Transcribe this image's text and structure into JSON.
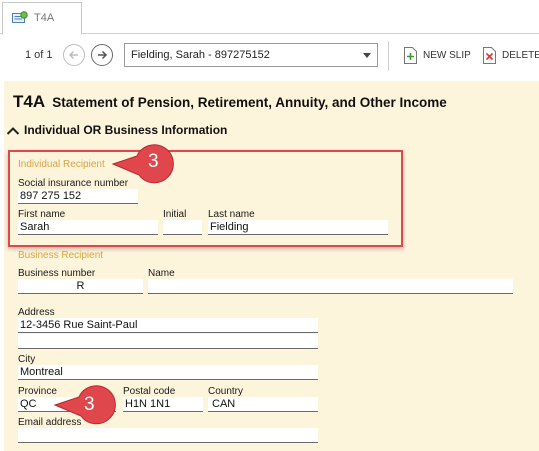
{
  "tab": {
    "label": "T4A"
  },
  "toolbar": {
    "pager": "1 of 1",
    "recipient_select": "Fielding, Sarah - 897275152",
    "new_slip": "NEW SLIP",
    "delete": "DELETE"
  },
  "form": {
    "code": "T4A",
    "title": "Statement of Pension, Retirement, Annuity, and Other Income",
    "section": "Individual OR Business Information",
    "individual": {
      "heading": "Individual Recipient",
      "sin_label": "Social insurance number",
      "sin": "897 275 152",
      "first_name_label": "First name",
      "first_name": "Sarah",
      "initial_label": "Initial",
      "initial": "",
      "last_name_label": "Last name",
      "last_name": "Fielding"
    },
    "business": {
      "heading": "Business Recipient",
      "number_label": "Business number",
      "number_r": "R",
      "name_label": "Name",
      "name": ""
    },
    "address_label": "Address",
    "address_line1": "12-3456 Rue Saint-Paul",
    "address_line2": "",
    "city_label": "City",
    "city": "Montreal",
    "province_label": "Province",
    "province": "QC",
    "postal_label": "Postal code",
    "postal": "H1N 1N1",
    "country_label": "Country",
    "country": "CAN",
    "email_label": "Email address",
    "email": ""
  },
  "callouts": {
    "top": "3",
    "bottom": "3"
  },
  "colors": {
    "form_bg": "#fdf4dc",
    "group_label": "#d9a441",
    "callout": "#e0474c"
  }
}
